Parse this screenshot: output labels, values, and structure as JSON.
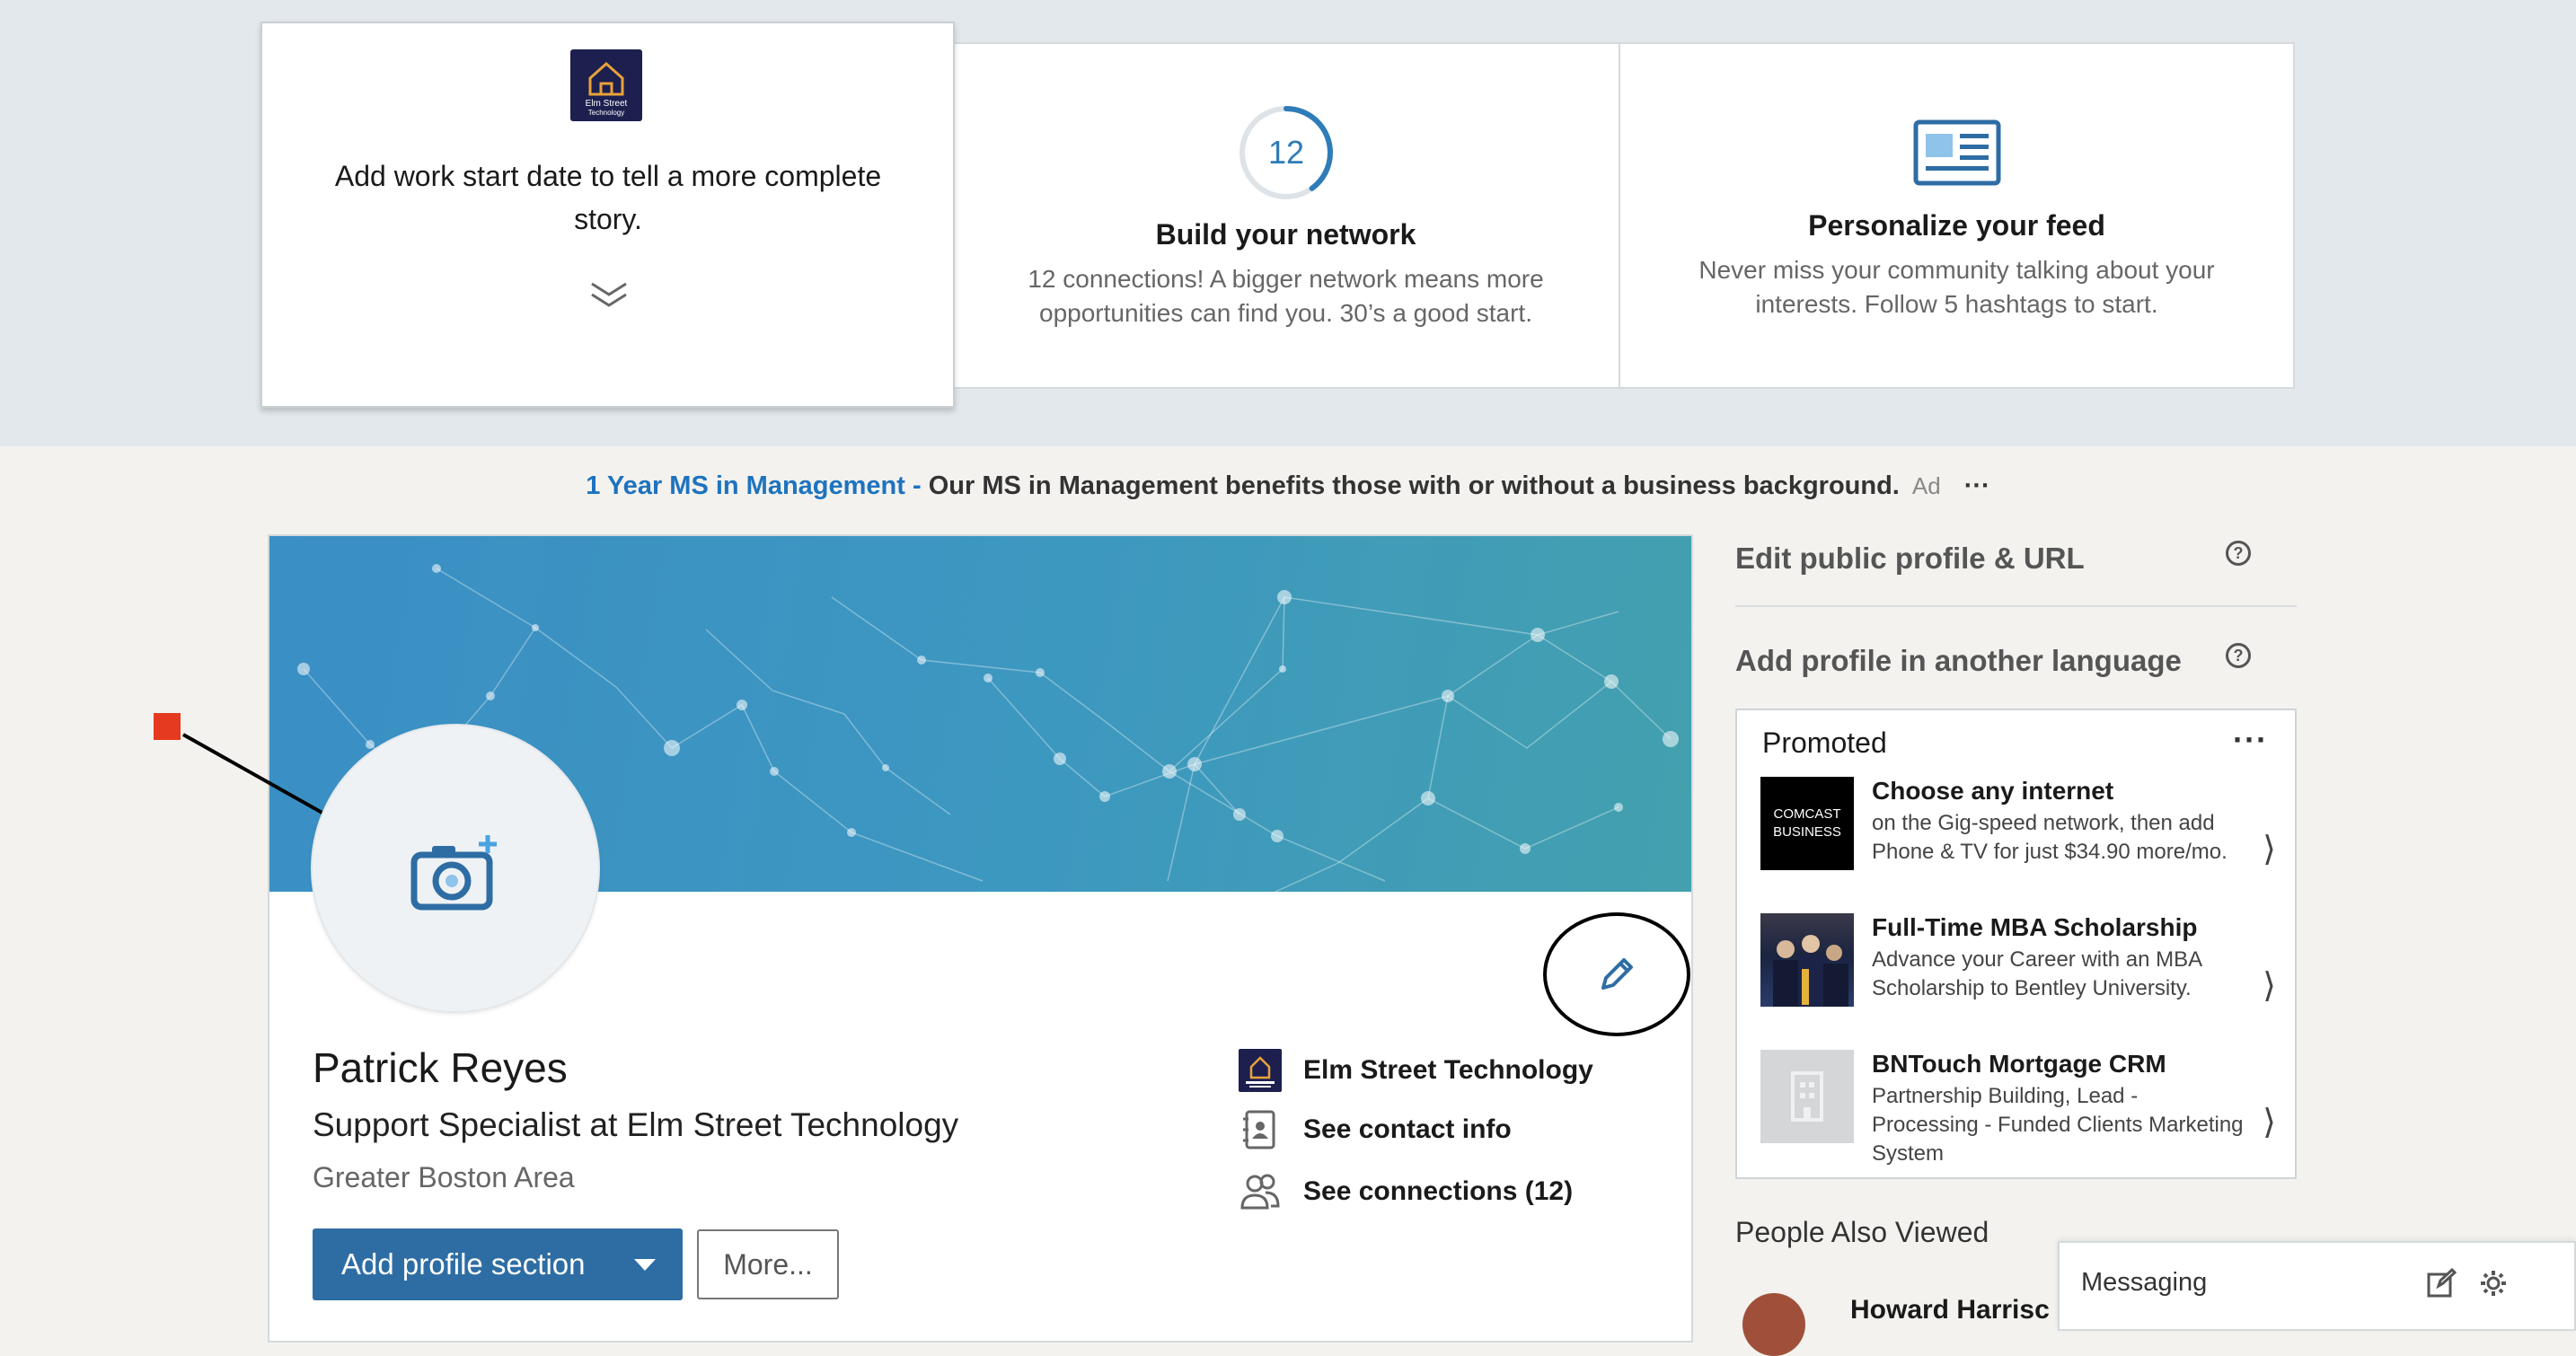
{
  "suggestions": {
    "work_date": {
      "logo_text": "Elm Street Technology",
      "text": "Add work start date to tell a more complete story."
    },
    "network": {
      "count": "12",
      "progress": 0.4,
      "title": "Build your network",
      "desc": "12 connections! A bigger network means more opportunities can find you. 30’s a good start."
    },
    "feed": {
      "title": "Personalize your feed",
      "desc": "Never miss your community talking about your interests. Follow 5 hashtags to start."
    }
  },
  "ad": {
    "link": "1 Year MS in Management - ",
    "text": "Our MS in Management benefits those with or without a business background.",
    "tag": "Ad",
    "menu": "···"
  },
  "profile": {
    "name": "Patrick Reyes",
    "headline": "Support Specialist at Elm Street Technology",
    "location": "Greater Boston Area",
    "add_section_label": "Add profile section",
    "more_label": "More...",
    "company": "Elm Street Technology",
    "contact_info": "See contact info",
    "connections": "See connections (12)"
  },
  "sidebar": {
    "edit_public": "Edit public profile & URL",
    "add_language": "Add profile in another language",
    "promoted": {
      "header": "Promoted",
      "menu": "···",
      "items": [
        {
          "title": "Choose any internet",
          "body": "on the Gig-speed network, then add Phone & TV for just $34.90 more/mo.",
          "thumb_text": "COMCAST BUSINESS"
        },
        {
          "title": "Full-Time MBA Scholarship",
          "body": "Advance your Career with an MBA Scholarship to Bentley University.",
          "thumb_text": ""
        },
        {
          "title": "BNTouch Mortgage CRM",
          "body": "Partnership Building, Lead - Processing - Funded Clients Marketing System",
          "thumb_text": ""
        }
      ]
    },
    "people_also_viewed": "People Also Viewed",
    "person_name": "Howard Harrisc"
  },
  "messaging": {
    "label": "Messaging"
  },
  "colors": {
    "accent": "#1e73be",
    "primary_button": "#2e6da4",
    "annotation": "#e53a1f"
  }
}
